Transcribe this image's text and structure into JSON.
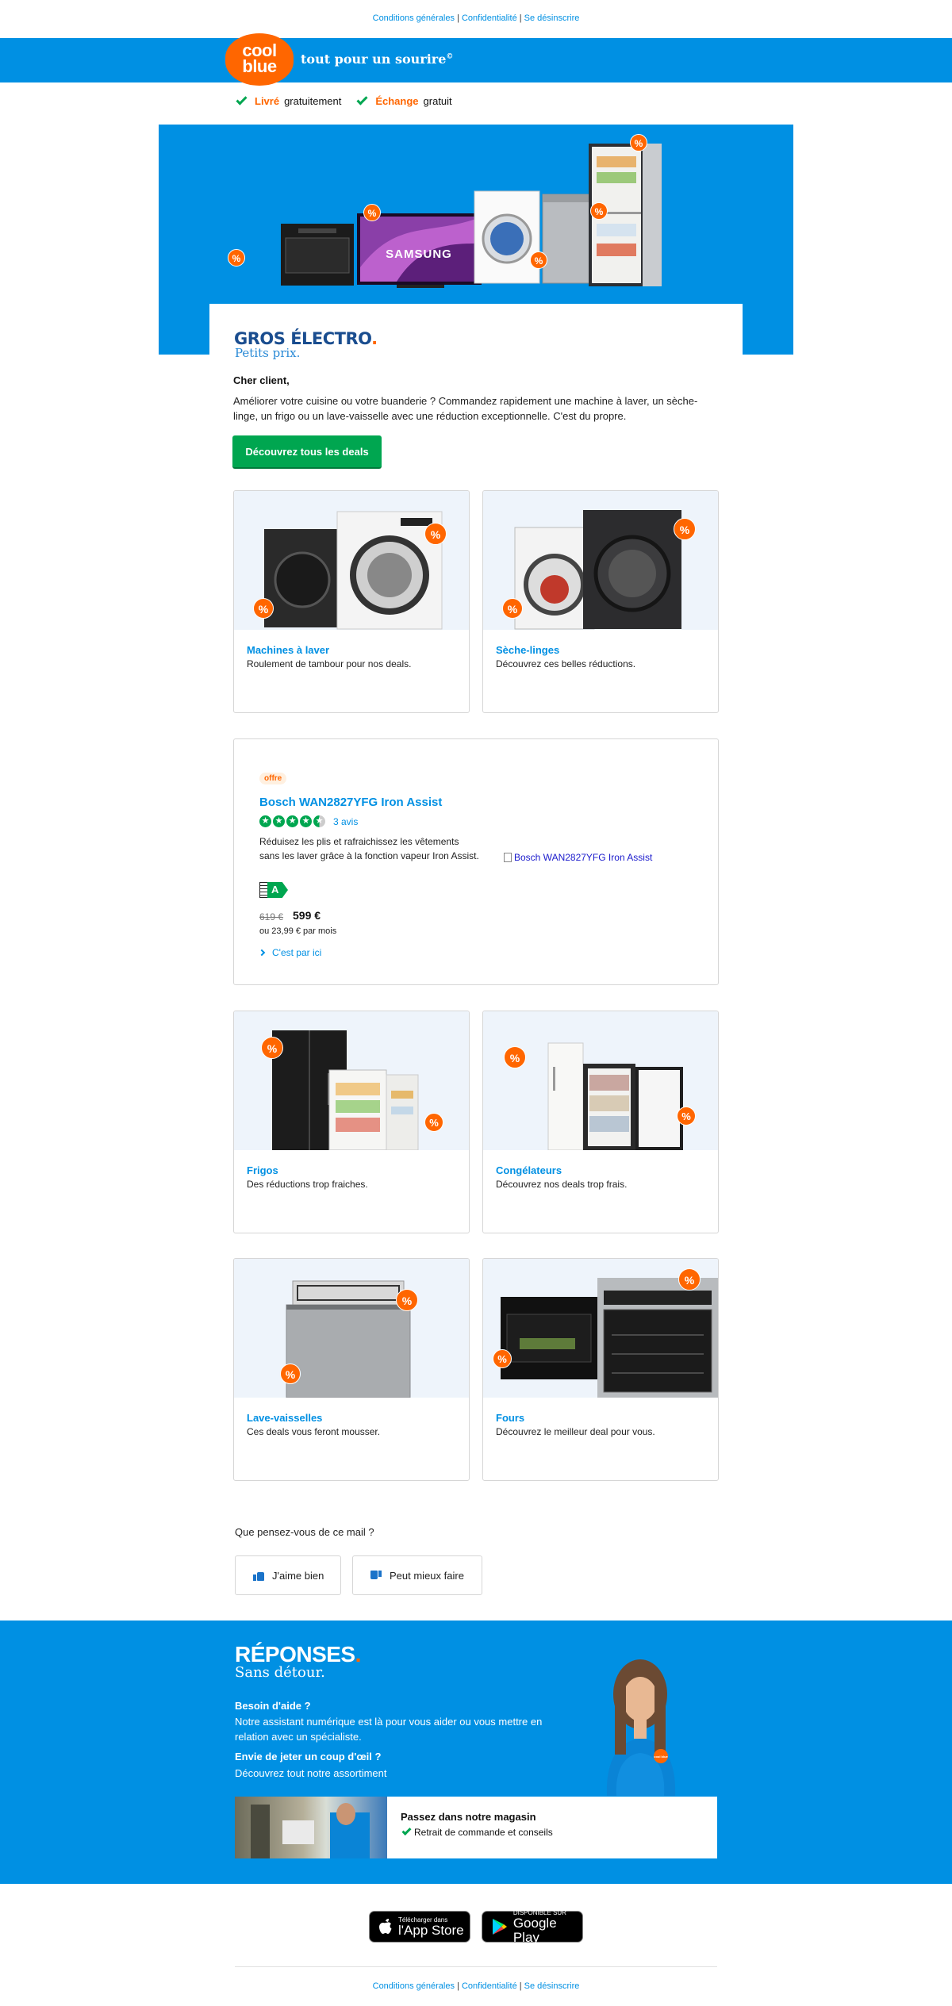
{
  "top_links": {
    "conditions": "Conditions générales",
    "privacy": "Confidentialité",
    "unsubscribe": "Se désinscrire",
    "sep": "|"
  },
  "header": {
    "logo_line1": "cool",
    "logo_line2": "blue",
    "tagline": "tout pour un sourire",
    "tagline_mark": "©"
  },
  "usps": [
    {
      "strong": "Livré",
      "rest": "gratuitement"
    },
    {
      "strong": "Échange",
      "rest": "gratuit"
    }
  ],
  "hero": {
    "brand_text": "SAMSUNG",
    "pct": "%",
    "title": "GROS ÉLECTRO",
    "title_dot": ".",
    "subtitle": "Petits prix."
  },
  "intro": {
    "greeting": "Cher client,",
    "text": "Améliorer votre cuisine ou votre buanderie ? Commandez rapidement une machine à laver, un sèche-linge, un frigo ou un lave-vaisselle avec une réduction exceptionnelle. C'est du propre.",
    "cta": "Découvrez tous les deals"
  },
  "categories": [
    {
      "title": "Machines à laver",
      "desc": "Roulement de tambour pour nos deals."
    },
    {
      "title": "Sèche-linges",
      "desc": "Découvrez ces belles réductions."
    },
    {
      "title": "Frigos",
      "desc": "Des réductions trop fraiches."
    },
    {
      "title": "Congélateurs",
      "desc": "Découvrez nos deals trop frais."
    },
    {
      "title": "Lave-vaisselles",
      "desc": "Ces deals vous feront mousser."
    },
    {
      "title": "Fours",
      "desc": "Découvrez le meilleur deal pour vous."
    }
  ],
  "product": {
    "badge": "offre",
    "title": "Bosch WAN2827YFG Iron Assist",
    "rating": 4.5,
    "reviews": "3 avis",
    "desc": "Réduisez les plis et rafraichissez les vêtements sans les laver grâce à la fonction vapeur Iron Assist.",
    "energy": "A",
    "old_price": "619 €",
    "price": "599 €",
    "monthly": "ou 23,99 € par mois",
    "link": "C'est par ici",
    "image_alt": "Bosch WAN2827YFG Iron Assist"
  },
  "feedback": {
    "question": "Que pensez-vous de ce mail ?",
    "like": "J'aime bien",
    "dislike": "Peut mieux faire"
  },
  "footer": {
    "title": "RÉPONSES",
    "title_dot": ".",
    "subtitle": "Sans détour.",
    "help_title": "Besoin d'aide ?",
    "help_text": "Notre assistant numérique est là pour vous aider ou vous mettre en relation avec un spécialiste.",
    "browse_title": "Envie de jeter un coup d'œil ?",
    "browse_text": "Découvrez tout notre assortiment",
    "store_title": "Passez dans notre magasin",
    "store_text": "Retrait de commande et conseils",
    "shirt_badge": "cool blue"
  },
  "apps": {
    "apple_small": "Télécharger dans",
    "apple_big": "l'App Store",
    "google_small": "DISPONIBLE SUR",
    "google_big": "Google Play"
  },
  "colors": {
    "brand_blue": "#0090e3",
    "brand_orange": "#ff6600",
    "cta_green": "#00a650"
  }
}
